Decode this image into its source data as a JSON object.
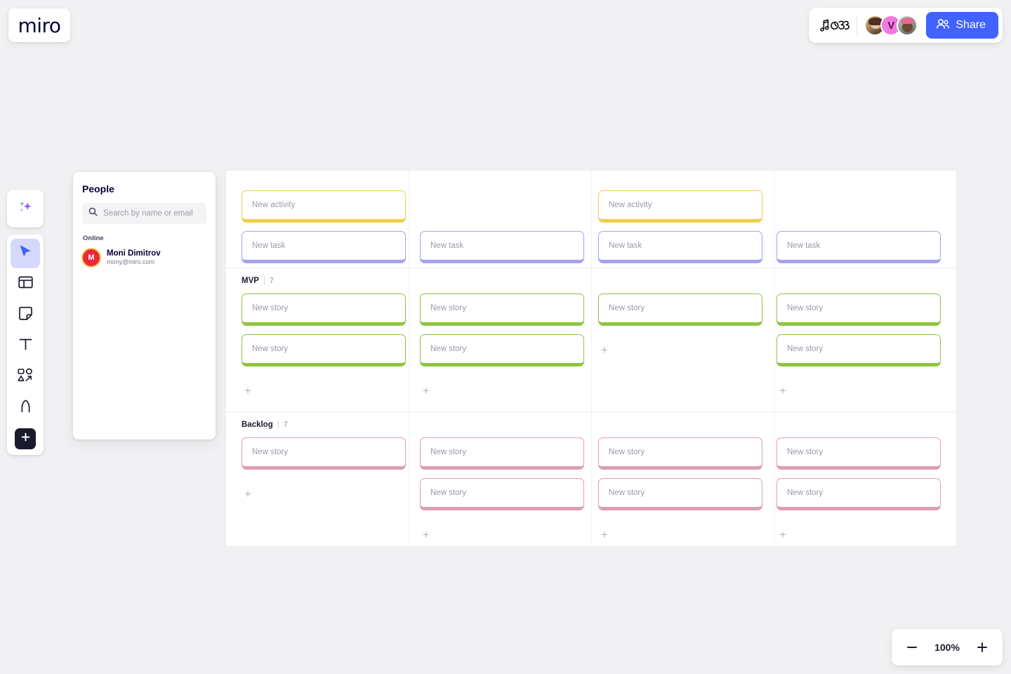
{
  "app": {
    "logo": "miro",
    "canvas_background": "#f1f1f3"
  },
  "topbar": {
    "doodle_icon": "music-notes-doodle-icon",
    "collaborators": [
      {
        "type": "photo",
        "name": "collaborator-1"
      },
      {
        "type": "initial",
        "initial": "V",
        "color": "#f07ae0"
      },
      {
        "type": "photo",
        "name": "collaborator-3"
      }
    ],
    "share_label": "Share",
    "share_color": "#4262ff",
    "share_icon": "people-icon"
  },
  "toolbar": {
    "ai": {
      "icon": "sparkles-icon",
      "label": "Miro AI"
    },
    "tools": [
      {
        "icon": "cursor-icon",
        "label": "Select",
        "active": true
      },
      {
        "icon": "templates-icon",
        "label": "Templates",
        "active": false
      },
      {
        "icon": "sticky-note-icon",
        "label": "Sticky note",
        "active": false
      },
      {
        "icon": "text-icon",
        "label": "Text",
        "active": false
      },
      {
        "icon": "shapes-icon",
        "label": "Shapes and connectors",
        "active": false
      },
      {
        "icon": "pen-icon",
        "label": "Pen",
        "active": false
      }
    ],
    "more": {
      "icon": "plus-icon",
      "label": "More apps"
    }
  },
  "people_panel": {
    "title": "People",
    "search": {
      "icon": "search-icon",
      "placeholder": "Search by name or email",
      "value": ""
    },
    "group_label": "Online",
    "members": [
      {
        "initial": "M",
        "name": "Moni Dimitrov",
        "email": "mony@miro.com",
        "avatar_color": "#e8283f",
        "ring_color": "#ffc943"
      }
    ]
  },
  "board": {
    "sections": [
      {
        "id": "activities",
        "name": "",
        "count": "",
        "show_header": false,
        "rows": [
          {
            "cells": [
              {
                "kind": "card",
                "color": "yellow",
                "text": "New activity"
              },
              {
                "kind": "empty"
              },
              {
                "kind": "card",
                "color": "yellow",
                "text": "New activity"
              },
              {
                "kind": "empty"
              }
            ]
          },
          {
            "cells": [
              {
                "kind": "card",
                "color": "purple",
                "text": "New task"
              },
              {
                "kind": "card",
                "color": "purple",
                "text": "New task"
              },
              {
                "kind": "card",
                "color": "purple",
                "text": "New task"
              },
              {
                "kind": "card",
                "color": "purple",
                "text": "New task"
              }
            ]
          }
        ]
      },
      {
        "id": "mvp",
        "name": "MVP",
        "count": "7",
        "show_header": true,
        "rows": [
          {
            "cells": [
              {
                "kind": "card",
                "color": "green",
                "text": "New story"
              },
              {
                "kind": "card",
                "color": "green",
                "text": "New story"
              },
              {
                "kind": "card",
                "color": "green",
                "text": "New story"
              },
              {
                "kind": "card",
                "color": "green",
                "text": "New story"
              }
            ]
          },
          {
            "cells": [
              {
                "kind": "card",
                "color": "green",
                "text": "New story"
              },
              {
                "kind": "card",
                "color": "green",
                "text": "New story"
              },
              {
                "kind": "add",
                "text": "+"
              },
              {
                "kind": "card",
                "color": "green",
                "text": "New story"
              }
            ]
          },
          {
            "cells": [
              {
                "kind": "add",
                "text": "+"
              },
              {
                "kind": "add",
                "text": "+"
              },
              {
                "kind": "empty"
              },
              {
                "kind": "add",
                "text": "+"
              }
            ]
          }
        ]
      },
      {
        "id": "backlog",
        "name": "Backlog",
        "count": "7",
        "show_header": true,
        "rows": [
          {
            "cells": [
              {
                "kind": "card",
                "color": "pink",
                "text": "New story"
              },
              {
                "kind": "card",
                "color": "pink",
                "text": "New story"
              },
              {
                "kind": "card",
                "color": "pink",
                "text": "New story"
              },
              {
                "kind": "card",
                "color": "pink",
                "text": "New story"
              }
            ]
          },
          {
            "cells": [
              {
                "kind": "add",
                "text": "+"
              },
              {
                "kind": "card",
                "color": "pink",
                "text": "New story"
              },
              {
                "kind": "card",
                "color": "pink",
                "text": "New story"
              },
              {
                "kind": "card",
                "color": "pink",
                "text": "New story"
              }
            ]
          },
          {
            "cells": [
              {
                "kind": "empty"
              },
              {
                "kind": "add",
                "text": "+"
              },
              {
                "kind": "add",
                "text": "+"
              },
              {
                "kind": "add",
                "text": "+"
              }
            ]
          }
        ]
      }
    ]
  },
  "zoom_control": {
    "minus_label": "−",
    "value": "100%",
    "plus_label": "+"
  }
}
